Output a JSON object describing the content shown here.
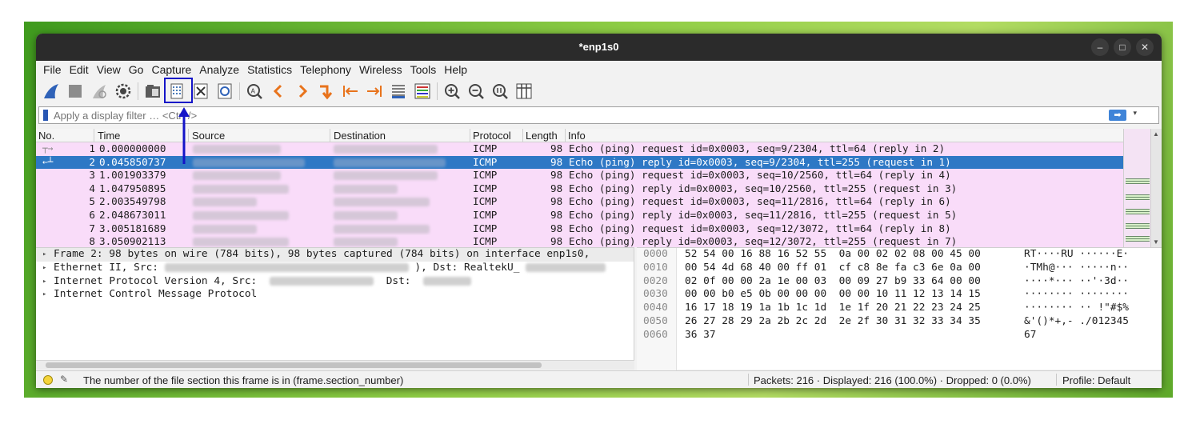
{
  "window": {
    "title": "*enp1s0",
    "controls": [
      "–",
      "□",
      "✕"
    ]
  },
  "menu": [
    "File",
    "Edit",
    "View",
    "Go",
    "Capture",
    "Analyze",
    "Statistics",
    "Telephony",
    "Wireless",
    "Tools",
    "Help"
  ],
  "toolbar": {
    "icons": [
      "shark-fin-start-icon",
      "stop-capture-icon",
      "restart-capture-icon",
      "capture-options-icon",
      "open-file-icon",
      "save-file-icon",
      "close-file-icon",
      "reload-file-icon",
      "find-packet-icon",
      "go-back-icon",
      "go-forward-icon",
      "go-to-packet-icon",
      "first-packet-icon",
      "last-packet-icon",
      "autoscroll-icon",
      "colorize-icon",
      "zoom-in-icon",
      "zoom-out-icon",
      "normal-size-icon",
      "resize-columns-icon"
    ]
  },
  "filter": {
    "placeholder": "Apply a display filter … <Ctrl-/>"
  },
  "packet_list": {
    "columns": [
      "No.",
      "Time",
      "Source",
      "Destination",
      "Protocol",
      "Length",
      "Info"
    ],
    "rows": [
      {
        "no": "1",
        "time": "0.000000000",
        "protocol": "ICMP",
        "length": "98",
        "info": "Echo (ping) request  id=0x0003, seq=9/2304, ttl=64 (reply in 2)"
      },
      {
        "no": "2",
        "time": "0.045850737",
        "protocol": "ICMP",
        "length": "98",
        "info": "Echo (ping) reply    id=0x0003, seq=9/2304, ttl=255 (request in 1)"
      },
      {
        "no": "3",
        "time": "1.001903379",
        "protocol": "ICMP",
        "length": "98",
        "info": "Echo (ping) request  id=0x0003, seq=10/2560, ttl=64 (reply in 4)"
      },
      {
        "no": "4",
        "time": "1.047950895",
        "protocol": "ICMP",
        "length": "98",
        "info": "Echo (ping) reply    id=0x0003, seq=10/2560, ttl=255 (request in 3)"
      },
      {
        "no": "5",
        "time": "2.003549798",
        "protocol": "ICMP",
        "length": "98",
        "info": "Echo (ping) request  id=0x0003, seq=11/2816, ttl=64 (reply in 6)"
      },
      {
        "no": "6",
        "time": "2.048673011",
        "protocol": "ICMP",
        "length": "98",
        "info": "Echo (ping) reply    id=0x0003, seq=11/2816, ttl=255 (request in 5)"
      },
      {
        "no": "7",
        "time": "3.005181689",
        "protocol": "ICMP",
        "length": "98",
        "info": "Echo (ping) request  id=0x0003, seq=12/3072, ttl=64 (reply in 8)"
      },
      {
        "no": "8",
        "time": "3.050902113",
        "protocol": "ICMP",
        "length": "98",
        "info": "Echo (ping) reply    id=0x0003, seq=12/3072, ttl=255 (request in 7)"
      }
    ]
  },
  "details": {
    "frame": "Frame 2: 98 bytes on wire (784 bits), 98 bytes captured (784 bits) on interface enp1s0,",
    "ethernet_a": "Ethernet II, Src:",
    "ethernet_b": "), Dst: RealtekU_",
    "ip_a": "Internet Protocol Version 4, Src:",
    "ip_b": "Dst:",
    "icmp": "Internet Control Message Protocol"
  },
  "hex": [
    {
      "off": "0000",
      "bytes": "52 54 00 16 88 16 52 55  0a 00 02 02 08 00 45 00",
      "ascii": "RT····RU ······E·"
    },
    {
      "off": "0010",
      "bytes": "00 54 4d 68 40 00 ff 01  cf c8 8e fa c3 6e 0a 00",
      "ascii": "·TMh@··· ·····n··"
    },
    {
      "off": "0020",
      "bytes": "02 0f 00 00 2a 1e 00 03  00 09 27 b9 33 64 00 00",
      "ascii": "····*··· ··'·3d··"
    },
    {
      "off": "0030",
      "bytes": "00 00 b0 e5 0b 00 00 00  00 00 10 11 12 13 14 15",
      "ascii": "········ ········"
    },
    {
      "off": "0040",
      "bytes": "16 17 18 19 1a 1b 1c 1d  1e 1f 20 21 22 23 24 25",
      "ascii": "········ ·· !\"#$%"
    },
    {
      "off": "0050",
      "bytes": "26 27 28 29 2a 2b 2c 2d  2e 2f 30 31 32 33 34 35",
      "ascii": "&'()*+,- ./012345"
    },
    {
      "off": "0060",
      "bytes": "36 37",
      "ascii": "67"
    }
  ],
  "status": {
    "text": "The number of the file section this frame is in (frame.section_number)",
    "packets": "Packets: 216 · Displayed: 216 (100.0%) · Dropped: 0 (0.0%)",
    "profile": "Profile: Default"
  },
  "colors": {
    "selected_row": "#2e78c5",
    "icmp_row": "#f9dcf9",
    "highlight": "#1414c8",
    "titlebar": "#2b2b2b"
  }
}
